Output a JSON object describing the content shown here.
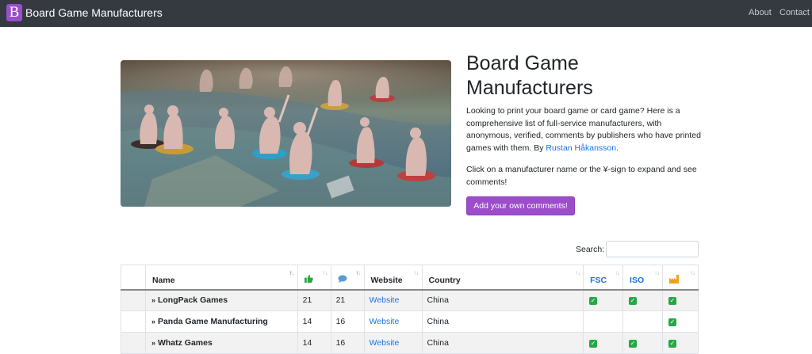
{
  "navbar": {
    "logo_letter": "B",
    "brand": "Board Game Manufacturers",
    "links": [
      "About",
      "Contact"
    ]
  },
  "hero": {
    "title": "Board Game Manufacturers",
    "desc_prefix": "Looking to print your board game or card game? Here is a comprehensive list of full-service manufacturers, with anonymous, verified, comments by publishers who have printed games with them. By ",
    "author": "Rustan Håkansson",
    "desc_suffix": ".",
    "hint": "Click on a manufacturer name or the ¥-sign to expand and see comments!",
    "button": "Add your own comments!"
  },
  "search": {
    "label": "Search:",
    "value": ""
  },
  "table": {
    "headers": {
      "name": "Name",
      "website": "Website",
      "country": "Country",
      "fsc": "FSC",
      "iso": "ISO"
    },
    "icons": {
      "likes": "thumbs-up-icon",
      "comments": "speech-bubble-icon",
      "factory": "factory-icon",
      "expand": "expand-chevron-icon",
      "check": "checkmark-icon"
    },
    "colors": {
      "accent": "#9b4dca",
      "link": "#1a73e8",
      "check": "#28a745",
      "factory": "#f0a020"
    },
    "rows": [
      {
        "name": "LongPack Games",
        "likes": "21",
        "comments": "21",
        "website": "Website",
        "country": "China",
        "fsc": true,
        "iso": true,
        "factory": true
      },
      {
        "name": "Panda Game Manufacturing",
        "likes": "14",
        "comments": "16",
        "website": "Website",
        "country": "China",
        "fsc": false,
        "iso": false,
        "factory": true
      },
      {
        "name": "Whatz Games",
        "likes": "14",
        "comments": "16",
        "website": "Website",
        "country": "China",
        "fsc": true,
        "iso": true,
        "factory": true
      }
    ]
  }
}
